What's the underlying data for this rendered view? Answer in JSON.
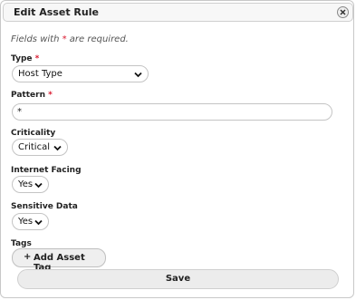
{
  "dialog": {
    "title": "Edit Asset Rule",
    "close_icon": "close-icon"
  },
  "note": {
    "prefix": "Fields with ",
    "star": "*",
    "suffix": " are required."
  },
  "fields": {
    "type": {
      "label": "Type",
      "required_mark": "*",
      "value": "Host Type"
    },
    "pattern": {
      "label": "Pattern",
      "required_mark": "*",
      "value": "*"
    },
    "criticality": {
      "label": "Criticality",
      "value": "Critical"
    },
    "internet_facing": {
      "label": "Internet Facing",
      "value": "Yes"
    },
    "sensitive_data": {
      "label": "Sensitive Data",
      "value": "Yes"
    },
    "tags": {
      "label": "Tags"
    }
  },
  "buttons": {
    "add_tag_icon": "+",
    "add_tag": "Add Asset Tag",
    "save": "Save"
  },
  "icons": {
    "chevron": "chevron-down-icon"
  }
}
